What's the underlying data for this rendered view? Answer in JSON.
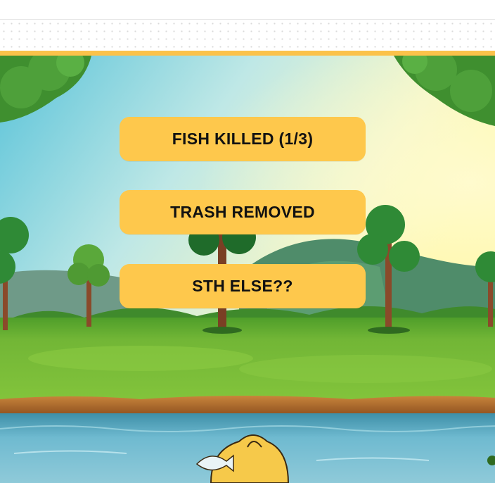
{
  "buttons": {
    "fish_killed": "FISH KILLED (1/3)",
    "trash_removed": "TRASH REMOVED",
    "something_else": "STH ELSE??"
  },
  "colors": {
    "button": "#fec84c",
    "accent_rule": "#fbc24a",
    "grass": "#76b935",
    "river": "#5fb1c9"
  },
  "icons": [
    "tree-icon",
    "bush-icon",
    "mountain-icon",
    "trash-bag-icon",
    "fish-icon"
  ]
}
